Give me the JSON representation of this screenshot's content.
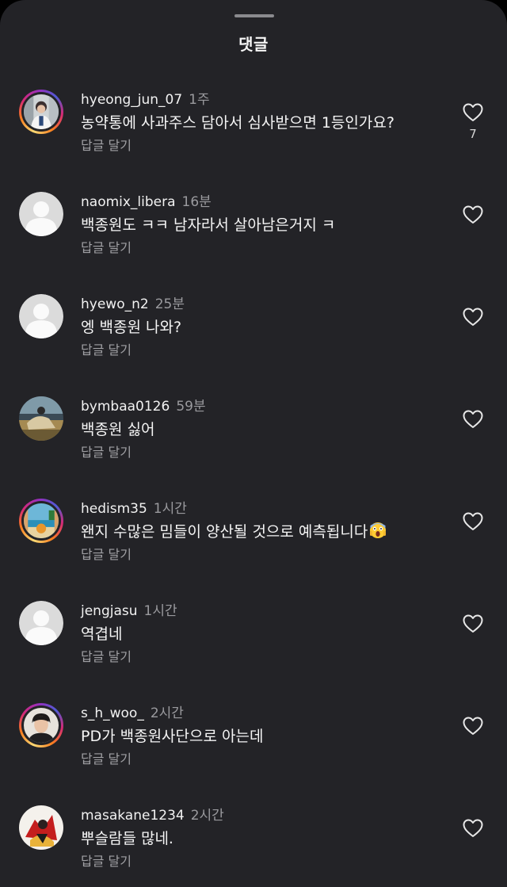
{
  "sheet": {
    "title": "댓글"
  },
  "comments": [
    {
      "username": "hyeong_jun_07",
      "time": "1주",
      "text": "농약통에 사과주스 담아서 심사받으면 1등인가요?",
      "reply_label": "답글 달기",
      "likes": "7",
      "avatar": "photo-person-office",
      "story_ring": true
    },
    {
      "username": "naomix_libera",
      "time": "16분",
      "text": "백종원도 ㅋㅋ 남자라서 살아남은거지 ㅋ",
      "reply_label": "답글 달기",
      "avatar": "default-avatar",
      "story_ring": false
    },
    {
      "username": "hyewo_n2",
      "time": "25분",
      "text": "엥 백종원 나와?",
      "reply_label": "답글 달기",
      "avatar": "default-avatar",
      "story_ring": false
    },
    {
      "username": "bymbaa0126",
      "time": "59분",
      "text": "백종원 싫어",
      "reply_label": "답글 달기",
      "avatar": "photo-horse-rider",
      "story_ring": false
    },
    {
      "username": "hedism35",
      "time": "1시간",
      "text": "왠지 수많은 밈들이 양산될 것으로 예측됩니다",
      "emoji": "screaming-face-emoji",
      "reply_label": "답글 달기",
      "avatar": "photo-beach-window",
      "story_ring": true
    },
    {
      "username": "jengjasu",
      "time": "1시간",
      "text": "역겹네",
      "reply_label": "답글 달기",
      "avatar": "default-avatar",
      "story_ring": false
    },
    {
      "username": "s_h_woo_",
      "time": "2시간",
      "text": "PD가 백종원사단으로 아는데",
      "reply_label": "답글 달기",
      "avatar": "photo-man-portrait",
      "story_ring": true
    },
    {
      "username": "masakane1234",
      "time": "2시간",
      "text": "뿌슬람들 많네.",
      "reply_label": "답글 달기",
      "avatar": "photo-illustration-red",
      "story_ring": false
    }
  ],
  "colors": {
    "background": "#232327",
    "text": "#f5f5f5",
    "secondary": "#9a9a9e"
  },
  "icons": {
    "like": "heart-outline-icon"
  }
}
